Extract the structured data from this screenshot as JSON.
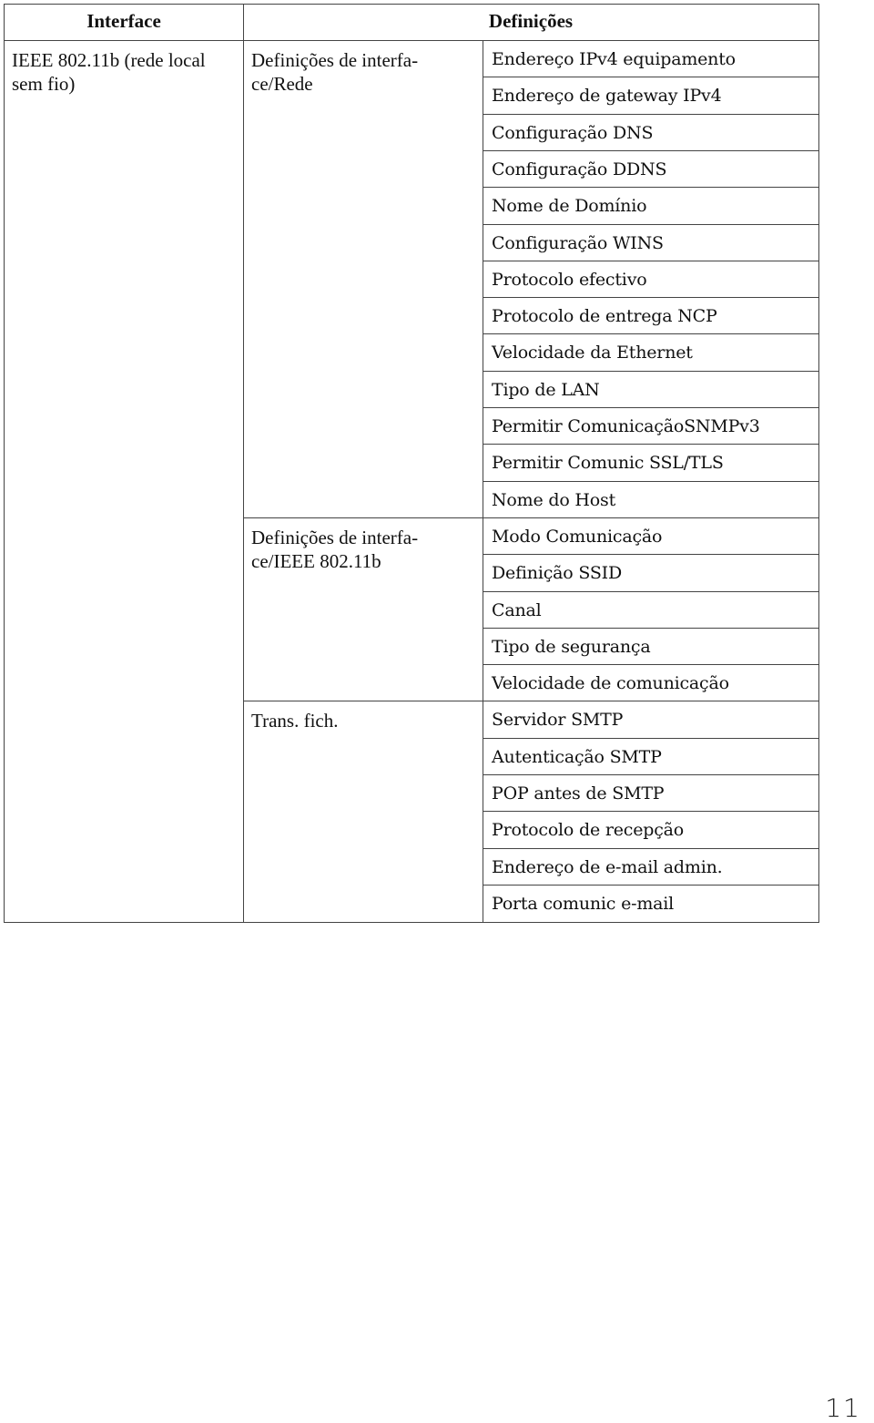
{
  "table": {
    "headers": {
      "interface": "Interface",
      "definitions": "Definições"
    },
    "interface_value": [
      "IEEE 802.11b (rede local",
      "sem fio)"
    ],
    "groups": [
      {
        "name_lines": [
          "Definições de interfa-",
          "ce/Rede"
        ],
        "items": [
          "Endereço IPv4 equipamento",
          "Endereço de gateway IPv4",
          "Configuração DNS",
          "Configuração DDNS",
          "Nome de Domínio",
          "Configuração WINS",
          "Protocolo efectivo",
          "Protocolo de entrega NCP",
          "Velocidade da Ethernet",
          "Tipo de LAN",
          "Permitir ComunicaçãoSNMPv3",
          "Permitir Comunic SSL/TLS",
          "Nome do Host"
        ]
      },
      {
        "name_lines": [
          "Definições de interfa-",
          "ce/IEEE 802.11b"
        ],
        "items": [
          "Modo Comunicação",
          "Definição SSID",
          "Canal",
          "Tipo de segurança",
          "Velocidade de comunicação"
        ]
      },
      {
        "name_lines": [
          "Trans. fich.",
          ""
        ],
        "items": [
          "Servidor SMTP",
          "Autenticação SMTP",
          "POP antes de SMTP",
          "Protocolo de recepção",
          "Endereço de e-mail admin.",
          "Porta comunic e-mail"
        ]
      }
    ]
  },
  "page_number": "11"
}
